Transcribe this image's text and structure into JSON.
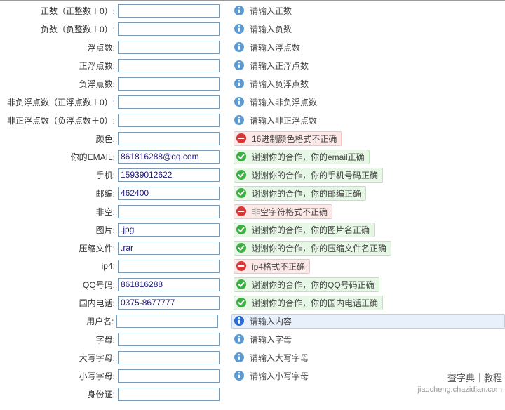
{
  "rows": [
    {
      "label": "正数（正整数＋0）:",
      "value": "",
      "status": "info",
      "message": "请输入正数"
    },
    {
      "label": "负数（负整数＋0）:",
      "value": "",
      "status": "info",
      "message": "请输入负数"
    },
    {
      "label": "浮点数:",
      "value": "",
      "status": "info",
      "message": "请输入浮点数"
    },
    {
      "label": "正浮点数:",
      "value": "",
      "status": "info",
      "message": "请输入正浮点数"
    },
    {
      "label": "负浮点数:",
      "value": "",
      "status": "info",
      "message": "请输入负浮点数"
    },
    {
      "label": "非负浮点数（正浮点数＋0）:",
      "value": "",
      "status": "info",
      "message": "请输入非负浮点数"
    },
    {
      "label": "非正浮点数（负浮点数＋0）:",
      "value": "",
      "status": "info",
      "message": "请输入非正浮点数"
    },
    {
      "label": "颜色:",
      "value": "",
      "status": "error",
      "message": "16进制颜色格式不正确"
    },
    {
      "label": "你的EMAIL:",
      "value": "861816288@qq.com",
      "status": "success",
      "message": "谢谢你的合作，你的email正确"
    },
    {
      "label": "手机:",
      "value": "15939012622",
      "status": "success",
      "message": "谢谢你的合作，你的手机号码正确"
    },
    {
      "label": "邮编:",
      "value": "462400",
      "status": "success",
      "message": "谢谢你的合作，你的邮编正确"
    },
    {
      "label": "非空:",
      "value": "",
      "status": "error",
      "message": "非空字符格式不正确"
    },
    {
      "label": "图片:",
      "value": ".jpg",
      "status": "success",
      "message": "谢谢你的合作，你的图片名正确"
    },
    {
      "label": "压缩文件:",
      "value": ".rar",
      "status": "success",
      "message": "谢谢你的合作，你的压缩文件名正确"
    },
    {
      "label": "ip4:",
      "value": "",
      "status": "error",
      "message": "ip4格式不正确"
    },
    {
      "label": "QQ号码:",
      "value": "861816288",
      "status": "success",
      "message": "谢谢你的合作，你的QQ号码正确"
    },
    {
      "label": "国内电话:",
      "value": "0375-8677777",
      "status": "success",
      "message": "谢谢你的合作，你的国内电话正确"
    },
    {
      "label": "用户名:",
      "value": "",
      "status": "focus",
      "message": "请输入内容"
    },
    {
      "label": "字母:",
      "value": "",
      "status": "info",
      "message": "请输入字母"
    },
    {
      "label": "大写字母:",
      "value": "",
      "status": "info",
      "message": "请输入大写字母"
    },
    {
      "label": "小写字母:",
      "value": "",
      "status": "info",
      "message": "请输入小写字母"
    },
    {
      "label": "身份证:",
      "value": "",
      "status": "none",
      "message": ""
    }
  ],
  "watermark": {
    "line1": "查字典｜教程",
    "line2": "jiaocheng.chazidian.com"
  }
}
